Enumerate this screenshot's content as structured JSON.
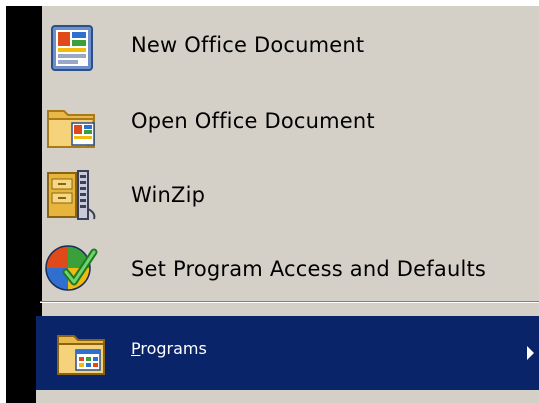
{
  "menu": {
    "items": [
      {
        "label": "New Office Document",
        "icon": "new-office-document-icon"
      },
      {
        "label": "Open Office Document",
        "icon": "open-office-document-icon"
      },
      {
        "label": "WinZip",
        "icon": "winzip-icon"
      },
      {
        "label": "Set Program Access and Defaults",
        "icon": "program-access-defaults-icon"
      }
    ],
    "programs": {
      "label_first": "P",
      "label_rest": "rograms",
      "icon": "programs-folder-icon",
      "highlight_color": "#0a246a"
    }
  },
  "colors": {
    "menu_background": "#d4d0c8",
    "side_band": "#000000",
    "selection": "#0a246a"
  }
}
